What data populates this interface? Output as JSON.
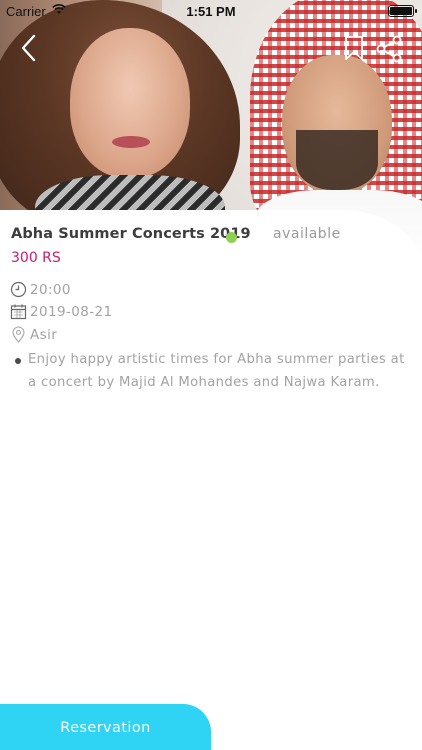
{
  "status_bar": {
    "carrier": "Carrier",
    "time": "1:51 PM"
  },
  "header": {
    "back_icon": "chevron-left-icon",
    "bookmark_icon": "bookmark-icon",
    "share_icon": "share-icon"
  },
  "event": {
    "title": "Abha Summer Concerts 2019",
    "availability": "available",
    "availability_color": "#8fd14f",
    "price": "300 RS",
    "price_color": "#c81c6a",
    "time": "20:00",
    "date": "2019-08-21",
    "location": "Asir",
    "description": "Enjoy happy artistic times for Abha summer parties at a concert by Majid Al Mohandes and Najwa Karam."
  },
  "actions": {
    "reservation_label": "Reservation",
    "accent_color": "#2fd3f3"
  }
}
